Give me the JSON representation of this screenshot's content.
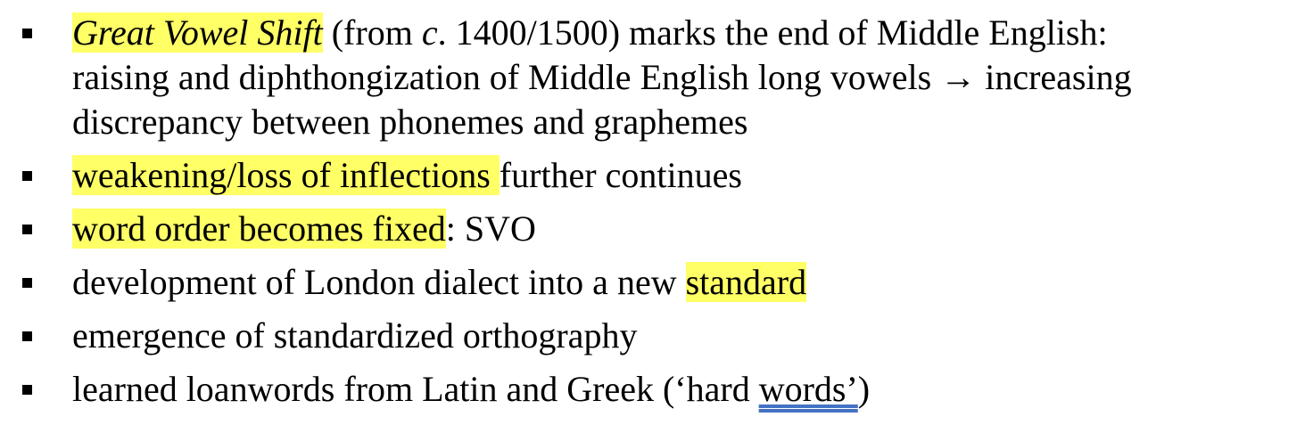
{
  "bullets": [
    {
      "lines": [
        {
          "segments": [
            {
              "text": "Great Vowel Shift",
              "style": "it hl"
            },
            {
              "text": " (from ",
              "style": ""
            },
            {
              "text": "c",
              "style": "it"
            },
            {
              "text": ". 1400/1500) marks the end of Middle English:",
              "style": ""
            }
          ]
        },
        {
          "segments": [
            {
              "text": "raising and diphthongization of Middle English long vowels → increasing",
              "style": ""
            }
          ]
        },
        {
          "segments": [
            {
              "text": "discrepancy between phonemes and graphemes",
              "style": ""
            }
          ]
        }
      ]
    },
    {
      "lines": [
        {
          "segments": [
            {
              "text": "weakening/loss of inflections ",
              "style": "hl"
            },
            {
              "text": "further continues",
              "style": ""
            }
          ]
        }
      ]
    },
    {
      "lines": [
        {
          "segments": [
            {
              "text": "word order becomes fixed",
              "style": "hl"
            },
            {
              "text": ": SVO",
              "style": ""
            }
          ]
        }
      ]
    },
    {
      "lines": [
        {
          "segments": [
            {
              "text": "development of London dialect into a new ",
              "style": ""
            },
            {
              "text": "standard",
              "style": "hl"
            }
          ]
        }
      ]
    },
    {
      "lines": [
        {
          "segments": [
            {
              "text": "emergence of standardized orthography",
              "style": ""
            }
          ]
        }
      ]
    },
    {
      "lines": [
        {
          "segments": [
            {
              "text": "learned loanwords from Latin and Greek (‘hard ",
              "style": ""
            },
            {
              "text": "words’",
              "style": "uline"
            },
            {
              "text": ")",
              "style": ""
            }
          ]
        }
      ]
    }
  ]
}
